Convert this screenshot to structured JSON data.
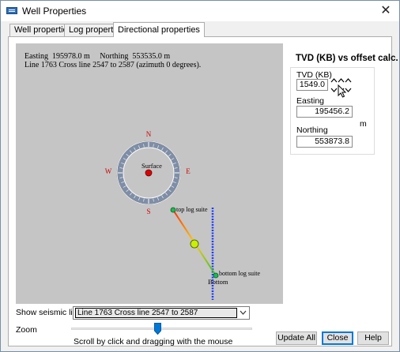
{
  "window": {
    "title": "Well Properties",
    "close_glyph": "✕",
    "icon": "well-app-icon"
  },
  "tabs": [
    {
      "label": "Well properties",
      "active": false
    },
    {
      "label": "Log properties",
      "active": false
    },
    {
      "label": "Directional properties",
      "active": true
    }
  ],
  "plot": {
    "info_line1": "Easting  195978.0 m     Northing  553535.0 m",
    "info_line2": "Line 1763 Cross line 2547 to 2587 (azimuth 0 degrees).",
    "compass": {
      "north": "N",
      "south": "S",
      "east": "E",
      "west": "W"
    },
    "surface_label": "Surface",
    "top_log_label": "top log suite",
    "bottom_log_label": "bottom log suite",
    "bottom_label": "Bottom",
    "colors": {
      "background": "#c5c5c5",
      "ring": "#7f8ea6",
      "ring_outline": "#5a5a5a",
      "compass_letters": "#d00000",
      "surface_marker": "#e00000",
      "seismic_line": "#1a3cff",
      "log_marker": "#1db954",
      "midpoint_marker": "#c8f000",
      "path_top": "#ff2a00",
      "path_mid": "#ffd000",
      "path_bottom": "#2dbf2d"
    }
  },
  "side": {
    "title": "TVD (KB)  vs offset calc.",
    "tvd_label": "TVD (KB)",
    "tvd_value": "1549.0",
    "easting_label": "Easting",
    "easting_value": "195456.2",
    "unit": "m",
    "northing_label": "Northing",
    "northing_value": "553873.8",
    "spinner_icons": [
      "spin-up-down-icon",
      "spin-up-down-icon",
      "spin-up-down-icon"
    ],
    "cursor": "arrow-cursor-icon"
  },
  "seismic": {
    "label": "Show seismic line",
    "selected": "Line 1763 Cross line 2547 to 2587"
  },
  "zoom": {
    "label": "Zoom",
    "help": "Scroll by click and dragging with the mouse",
    "slider_fraction": 0.48
  },
  "buttons": {
    "update_all": "Update All",
    "close": "Close",
    "help": "Help"
  }
}
